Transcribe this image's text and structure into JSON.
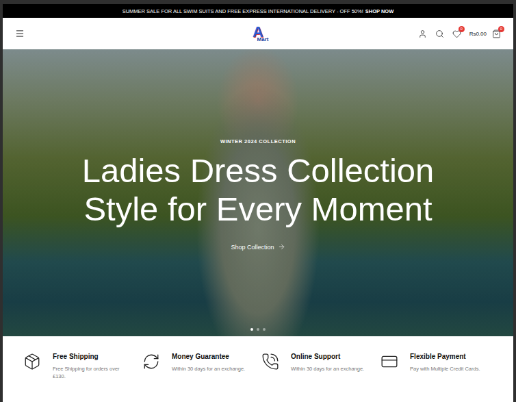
{
  "announcement": {
    "text": "SUMMER SALE FOR ALL SWIM SUITS AND FREE EXPRESS INTERNATIONAL DELIVERY - OFF 50%!",
    "link": "SHOP NOW"
  },
  "header": {
    "logo": {
      "initial": "A",
      "name": "Mart"
    },
    "wishlist_count": "0",
    "cart_total": "Rs0.00",
    "cart_count": "0"
  },
  "hero": {
    "eyebrow": "WINTER 2024 COLLECTION",
    "title_lines": [
      "Ladies Dress Collection",
      "Style for Every Moment"
    ],
    "cta": "Shop Collection",
    "slides": [
      {
        "selected": true
      },
      {
        "selected": false
      },
      {
        "selected": false
      }
    ]
  },
  "features": [
    {
      "kind": "shipping",
      "title": "Free Shipping",
      "text": "Free Shipping for orders over £130."
    },
    {
      "kind": "money",
      "title": "Money Guarantee",
      "text": "Within 30 days for an exchange."
    },
    {
      "kind": "support",
      "title": "Online Support",
      "text": "Within 30 days for an exchange."
    },
    {
      "kind": "payment",
      "title": "Flexible Payment",
      "text": "Pay with Multiple Credit Cards."
    }
  ]
}
